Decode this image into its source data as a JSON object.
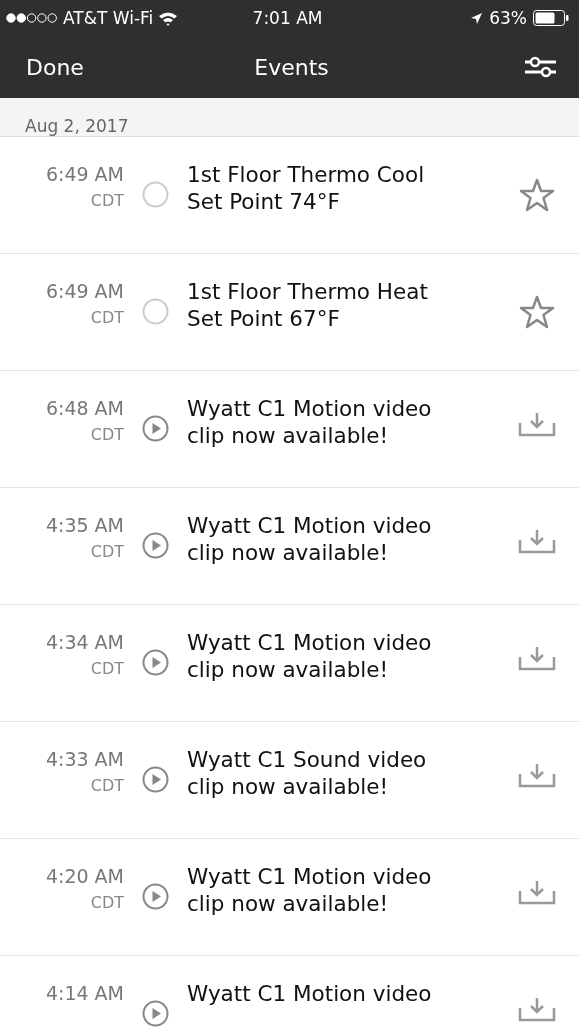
{
  "status_bar": {
    "carrier": "AT&T Wi-Fi",
    "time": "7:01 AM",
    "battery": "63%"
  },
  "nav": {
    "left": "Done",
    "title": "Events"
  },
  "section": {
    "date": "Aug 2, 2017"
  },
  "events": [
    {
      "kind": "setpoint",
      "time": "6:49 AM",
      "zone": "CDT",
      "lines": [
        "1st Floor Thermo Cool",
        "Set Point 74°F"
      ]
    },
    {
      "kind": "setpoint",
      "time": "6:49 AM",
      "zone": "CDT",
      "lines": [
        "1st Floor Thermo Heat",
        "Set Point 67°F"
      ]
    },
    {
      "kind": "video",
      "time": "6:48 AM",
      "zone": "CDT",
      "lines": [
        "Wyatt C1 Motion video",
        "clip now available!"
      ]
    },
    {
      "kind": "video",
      "time": "4:35 AM",
      "zone": "CDT",
      "lines": [
        "Wyatt C1 Motion video",
        "clip now available!"
      ]
    },
    {
      "kind": "video",
      "time": "4:34 AM",
      "zone": "CDT",
      "lines": [
        "Wyatt C1 Motion video",
        "clip now available!"
      ]
    },
    {
      "kind": "video",
      "time": "4:33 AM",
      "zone": "CDT",
      "lines": [
        "Wyatt C1 Sound video",
        "clip now available!"
      ]
    },
    {
      "kind": "video",
      "time": "4:20 AM",
      "zone": "CDT",
      "lines": [
        "Wyatt C1 Motion video",
        "clip now available!"
      ]
    },
    {
      "kind": "video",
      "time": "4:14 AM",
      "lines": [
        "Wyatt C1 Motion video"
      ]
    }
  ]
}
